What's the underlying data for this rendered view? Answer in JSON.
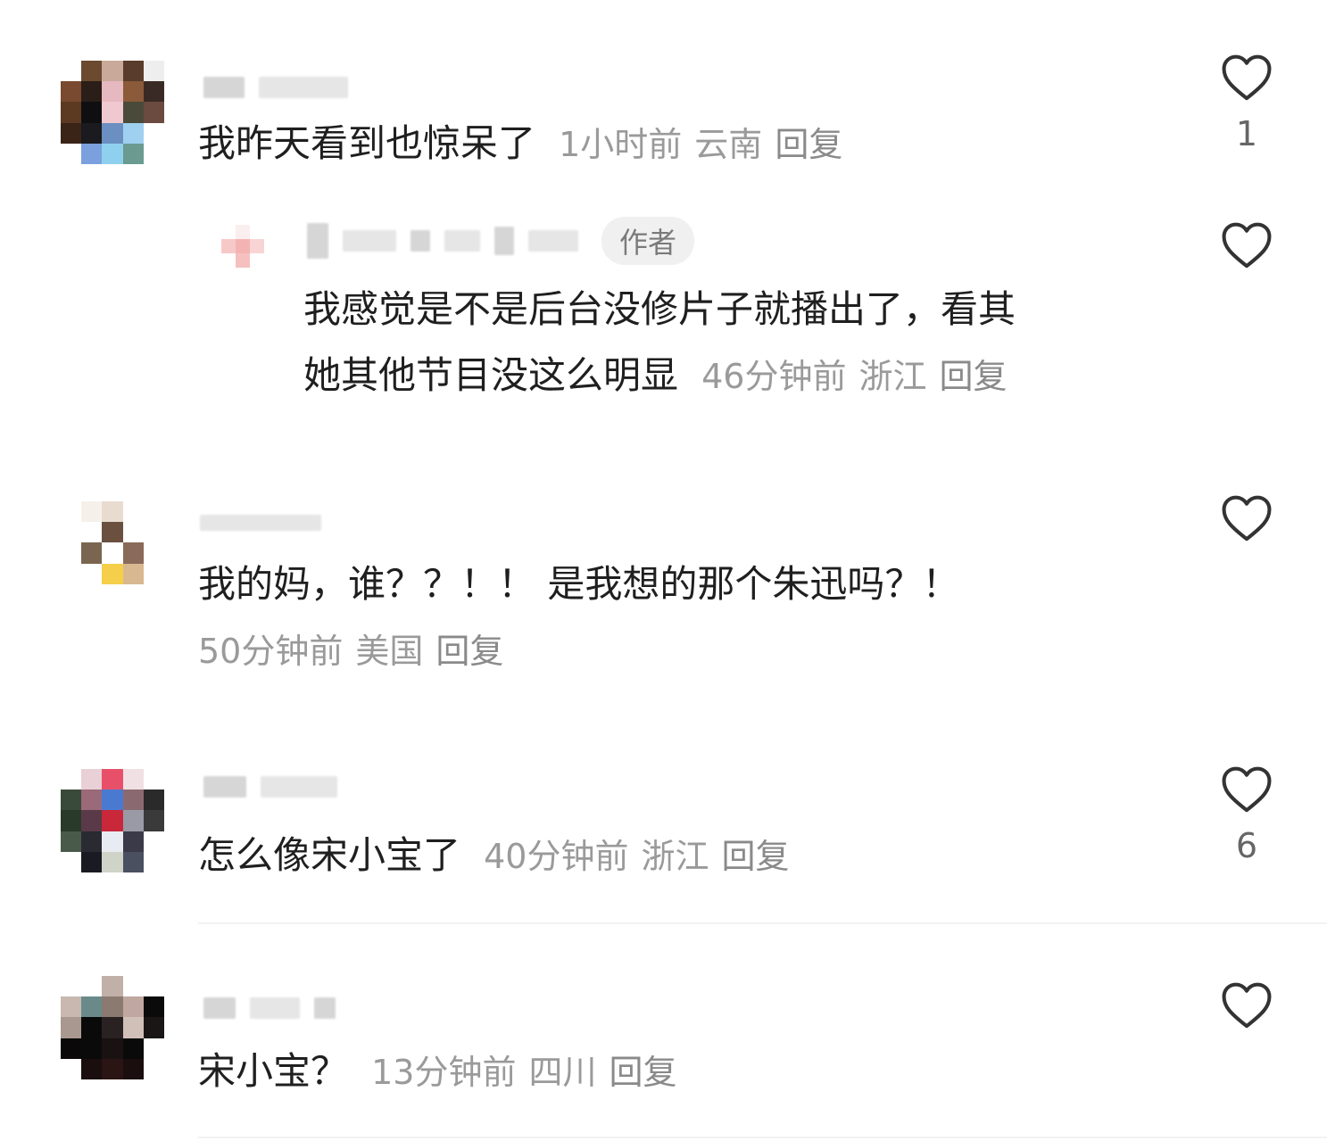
{
  "comments": [
    {
      "text": "我昨天看到也惊呆了",
      "time": "1小时前",
      "location": "云南",
      "reply_label": "回复",
      "likes": "1",
      "replies": [
        {
          "author_badge": "作者",
          "text_line1": "我感觉是不是后台没修片子就播出了，看其",
          "text_line2": "她其他节目没这么明显",
          "time": "46分钟前",
          "location": "浙江",
          "reply_label": "回复"
        }
      ]
    },
    {
      "text": "我的妈，谁？？！！ 是我想的那个朱迅吗？！",
      "time": "50分钟前",
      "location": "美国",
      "reply_label": "回复",
      "likes": ""
    },
    {
      "text": "怎么像宋小宝了",
      "time": "40分钟前",
      "location": "浙江",
      "reply_label": "回复",
      "likes": "6"
    },
    {
      "text": "宋小宝？",
      "time": "13分钟前",
      "location": "四川",
      "reply_label": "回复",
      "likes": ""
    }
  ],
  "icons": {
    "like": "heart-outline-icon"
  },
  "colors": {
    "text": "#1f1f1f",
    "meta": "#9a9a9a",
    "badge_bg": "#f0f0f0"
  }
}
